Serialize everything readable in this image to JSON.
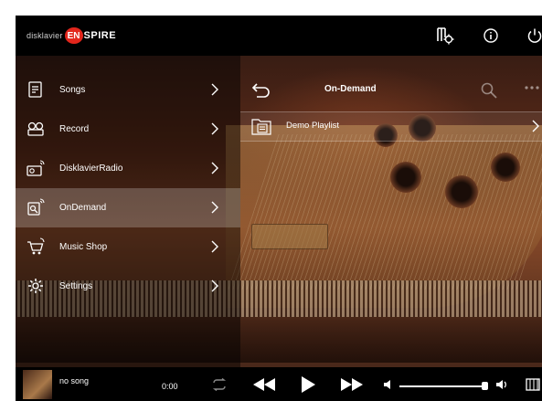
{
  "header": {
    "brand_prefix": "disklavier",
    "brand_en": "EN",
    "brand_suffix": "SPIRE",
    "icons": [
      "library-settings-icon",
      "info-icon",
      "power-icon"
    ]
  },
  "sidebar": {
    "items": [
      {
        "label": "Songs",
        "icon": "songs-icon"
      },
      {
        "label": "Record",
        "icon": "record-icon"
      },
      {
        "label": "DisklavierRadio",
        "icon": "radio-icon"
      },
      {
        "label": "OnDemand",
        "icon": "ondemand-icon",
        "active": true
      },
      {
        "label": "Music Shop",
        "icon": "cart-icon"
      },
      {
        "label": "Settings",
        "icon": "gear-icon"
      }
    ]
  },
  "panel": {
    "title": "On-Demand",
    "rows": [
      {
        "label": "Demo Playlist",
        "icon": "playlist-icon"
      }
    ]
  },
  "player": {
    "song": "no song",
    "time": "0:00",
    "volume": 0.97
  },
  "colors": {
    "brand_red": "#e3261c",
    "header_bg": "#000000",
    "active_item_bg": "rgba(255,255,255,0.22)"
  }
}
